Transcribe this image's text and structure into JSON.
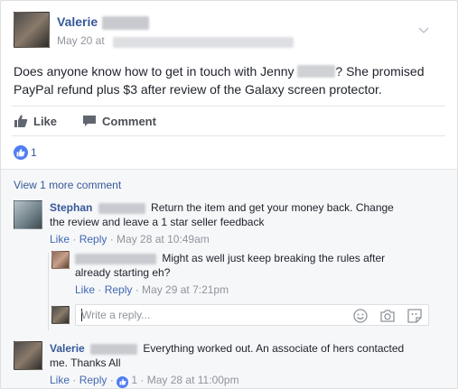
{
  "post": {
    "author": "Valerie",
    "date": "May 20 at",
    "text_part1": "Does anyone know how to get in touch with Jenny",
    "text_part2": "? She promised PayPal refund plus $3 after review of the Galaxy screen protector."
  },
  "actions": {
    "like_label": "Like",
    "comment_label": "Comment"
  },
  "reactions": {
    "count": "1"
  },
  "comments_section": {
    "view_more": "View 1 more comment",
    "comments": [
      {
        "author": "Stephan",
        "text": "Return the item and get your money back. Change the review and leave a 1 star seller feedback",
        "like": "Like",
        "reply": "Reply",
        "date": "May 28 at 10:49am"
      },
      {
        "author": "",
        "text": "Might as well just keep breaking the rules after already starting eh?",
        "like": "Like",
        "reply": "Reply",
        "date": "May 29 at 7:21pm"
      },
      {
        "author": "Valerie",
        "text": "Everything worked out. An associate of hers contacted me. Thanks All",
        "like": "Like",
        "reply": "Reply",
        "reaction_count": "1",
        "date": "May 28 at 11:00pm"
      }
    ],
    "reply_placeholder": "Write a reply..."
  },
  "icons": [
    "thumbs-up-icon",
    "comment-icon",
    "like-reaction-icon",
    "chevron-down-icon",
    "emoji-icon",
    "camera-icon",
    "sticker-icon"
  ],
  "colors": {
    "link": "#365899",
    "meta": "#90949c",
    "like_blue": "#4f7df4",
    "comments_bg": "#f6f7f9"
  }
}
